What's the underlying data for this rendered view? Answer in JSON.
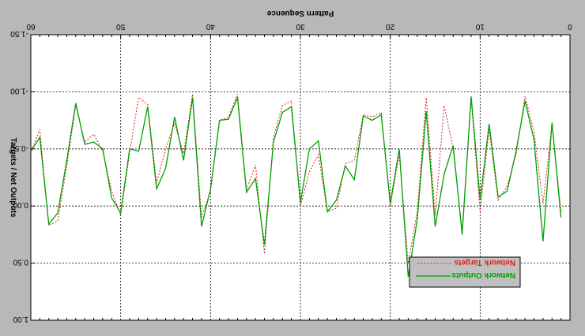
{
  "chart_data": {
    "type": "line",
    "title": "Pattern Sequence",
    "ylabel": "Targets / Net Outputs",
    "xlabel": "",
    "xlim": [
      0,
      60
    ],
    "ylim": [
      -1.5,
      1.0
    ],
    "x_ticks": [
      0,
      10,
      20,
      30,
      40,
      50,
      60
    ],
    "y_ticks": [
      1.0,
      0.5,
      0.0,
      -0.5,
      -1.0,
      -1.5
    ],
    "y_tick_labels": [
      "1.00",
      "0.50",
      "0.00",
      "-0.50",
      "-1.00",
      "-1.50"
    ],
    "grid": true,
    "rendered_flipped": true,
    "colors": {
      "background": "#b8b8b8",
      "plot_area": "#ffffff",
      "targets": "#e02020",
      "outputs": "#00a000",
      "grid": "#000000",
      "legend_box": "#c0c0c0"
    },
    "legend_placement": "bottom-right",
    "series": [
      {
        "name": "Network Targets",
        "style": "dashed",
        "x": [
          1,
          2,
          3,
          4,
          5,
          6,
          7,
          8,
          9,
          10,
          11,
          12,
          13,
          14,
          15,
          16,
          17,
          18,
          19,
          20,
          21,
          22,
          23,
          24,
          25,
          26,
          27,
          28,
          29,
          30,
          31,
          32,
          33,
          34,
          35,
          36,
          37,
          38,
          39,
          40,
          41,
          42,
          43,
          44,
          45,
          46,
          47,
          48,
          49,
          50,
          51,
          52,
          53,
          54,
          55,
          56,
          57,
          58,
          59,
          60
        ],
        "values": [
          0.05,
          -0.72,
          -0.02,
          -0.65,
          -0.96,
          -0.45,
          -0.17,
          -0.05,
          -0.67,
          0.05,
          -0.94,
          0.22,
          -0.5,
          -0.88,
          0.08,
          -0.95,
          0.05,
          0.5,
          -0.45,
          0.0,
          -0.82,
          -0.78,
          -0.8,
          -0.4,
          -0.37,
          0.02,
          0.05,
          -0.45,
          -0.3,
          0.0,
          -0.92,
          -0.88,
          -0.6,
          0.42,
          -0.36,
          -0.14,
          -0.98,
          -0.78,
          -0.75,
          -0.13,
          0.1,
          -0.98,
          -0.46,
          -0.72,
          -0.5,
          -0.2,
          -0.89,
          -0.95,
          -0.47,
          0.08,
          -0.13,
          -0.48,
          -0.63,
          -0.56,
          -0.88,
          -0.35,
          0.13,
          0.17,
          -0.67,
          -0.47
        ]
      },
      {
        "name": "Network Outputs",
        "style": "solid",
        "x": [
          1,
          2,
          3,
          4,
          5,
          6,
          7,
          8,
          9,
          10,
          11,
          12,
          13,
          14,
          15,
          16,
          17,
          18,
          19,
          20,
          21,
          22,
          23,
          24,
          25,
          26,
          27,
          28,
          29,
          30,
          31,
          32,
          33,
          34,
          35,
          36,
          37,
          38,
          39,
          40,
          41,
          42,
          43,
          44,
          45,
          46,
          47,
          48,
          49,
          50,
          51,
          52,
          53,
          54,
          55,
          56,
          57,
          58,
          59,
          60
        ],
        "values": [
          0.1,
          -0.73,
          0.31,
          -0.58,
          -0.92,
          -0.48,
          -0.13,
          -0.08,
          -0.72,
          -0.05,
          -0.96,
          0.25,
          -0.53,
          -0.28,
          0.18,
          -0.83,
          0.12,
          0.62,
          -0.5,
          -0.02,
          -0.8,
          -0.75,
          -0.79,
          -0.23,
          -0.35,
          -0.05,
          0.05,
          -0.57,
          -0.5,
          -0.03,
          -0.87,
          -0.82,
          -0.56,
          0.34,
          -0.24,
          -0.12,
          -0.95,
          -0.76,
          -0.75,
          -0.15,
          0.18,
          -0.95,
          -0.4,
          -0.78,
          -0.33,
          -0.15,
          -0.87,
          -0.48,
          -0.5,
          0.06,
          -0.07,
          -0.5,
          -0.56,
          -0.54,
          -0.9,
          -0.4,
          0.06,
          0.16,
          -0.6,
          -0.48
        ]
      }
    ]
  }
}
